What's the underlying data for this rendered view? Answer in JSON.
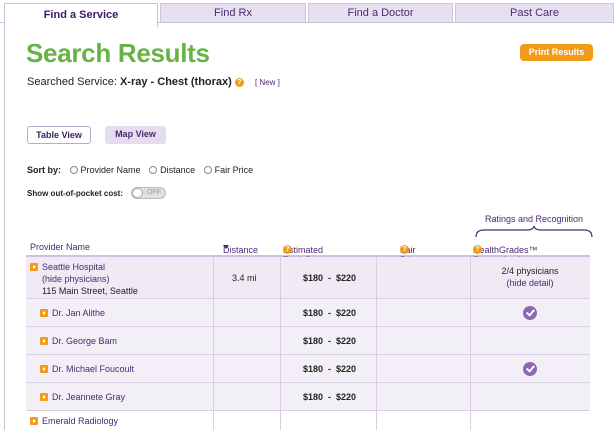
{
  "tabs": [
    {
      "label": "Find a Service"
    },
    {
      "label": "Find Rx"
    },
    {
      "label": "Find a Doctor"
    },
    {
      "label": "Past Care"
    }
  ],
  "title": "Search Results",
  "print_button": "Print Results",
  "searched": {
    "label": "Searched Service:",
    "service": "X-ray - Chest (thorax)",
    "new_link": "[ New ]"
  },
  "views": {
    "table": "Table View",
    "map": "Map View"
  },
  "sort": {
    "label": "Sort by:",
    "options": [
      "Provider Name",
      "Distance",
      "Fair Price"
    ]
  },
  "oop": {
    "label": "Show out-of-pocket cost:",
    "toggle": "OFF"
  },
  "ratings_header": "Ratings and Recognition",
  "columns": {
    "provider": "Provider Name",
    "distance": "Distance",
    "cost": "Estimated Total Cost",
    "fair": "Fair Price",
    "hg": "HealthGrades™ Recognized"
  },
  "rows": {
    "seattle": {
      "name": "Seattle Hospital",
      "hide": "(hide physicians)",
      "address": "115 Main Street, Seattle",
      "distance": "3.4 mi",
      "cost": "$180  -  $220",
      "physicians": "2/4 physicians",
      "hide_detail": "(hide detail)"
    },
    "doctors": [
      {
        "name": "Dr. Jan Alithe",
        "cost": "$180  -  $220",
        "recognized": true
      },
      {
        "name": "Dr. George Bam",
        "cost": "$180  -  $220",
        "recognized": false
      },
      {
        "name": "Dr. Michael Foucoult",
        "cost": "$180  -  $220",
        "recognized": true
      },
      {
        "name": "Dr. Jeannete Gray",
        "cost": "$180  -  $220",
        "recognized": false
      }
    ],
    "emerald": {
      "name": "Emerald Radiology"
    }
  },
  "colors": {
    "accent": "#f29b19",
    "purple": "#4a2a72",
    "green": "#67b345"
  }
}
